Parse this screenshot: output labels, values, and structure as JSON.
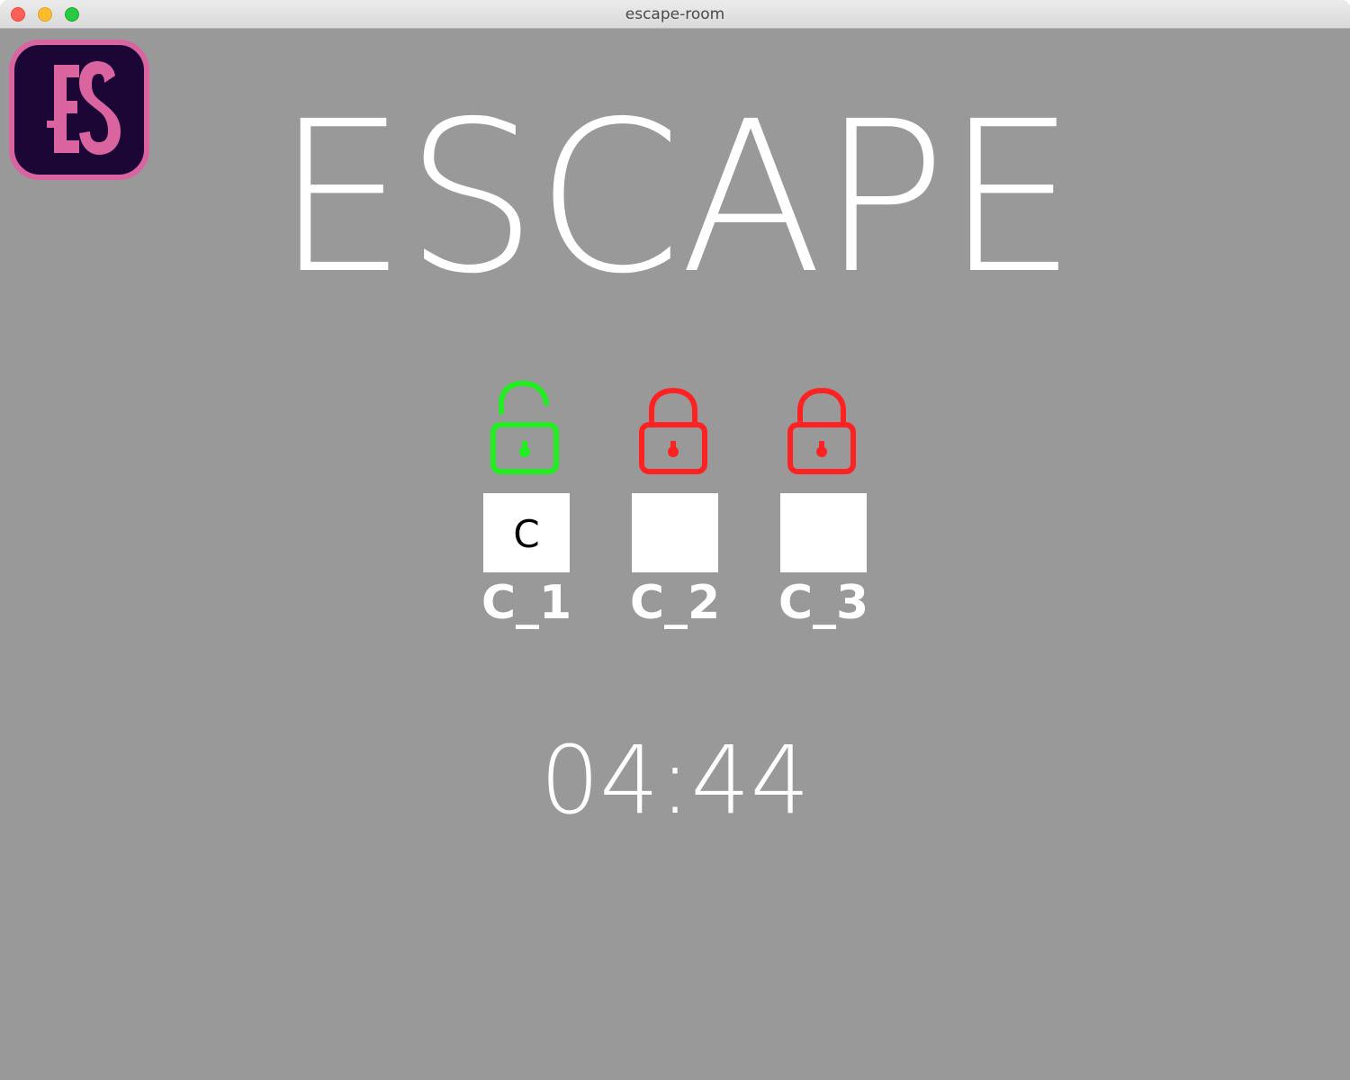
{
  "window": {
    "title": "escape-room"
  },
  "logo": {
    "text": "ES",
    "colors": {
      "background": "#1c0636",
      "accent": "#d9649f"
    }
  },
  "title": "ESCAPE",
  "locks": [
    {
      "label": "C_1",
      "value": "C",
      "state": "unlocked",
      "icon": "lock-open-icon",
      "color": "#22ee22"
    },
    {
      "label": "C_2",
      "value": "",
      "state": "locked",
      "icon": "lock-closed-icon",
      "color": "#ff2222"
    },
    {
      "label": "C_3",
      "value": "",
      "state": "locked",
      "icon": "lock-closed-icon",
      "color": "#ff2222"
    }
  ],
  "timer": "04:44",
  "colors": {
    "background": "#999999",
    "text": "#ffffff",
    "unlocked": "#22ee22",
    "locked": "#ff2222"
  }
}
